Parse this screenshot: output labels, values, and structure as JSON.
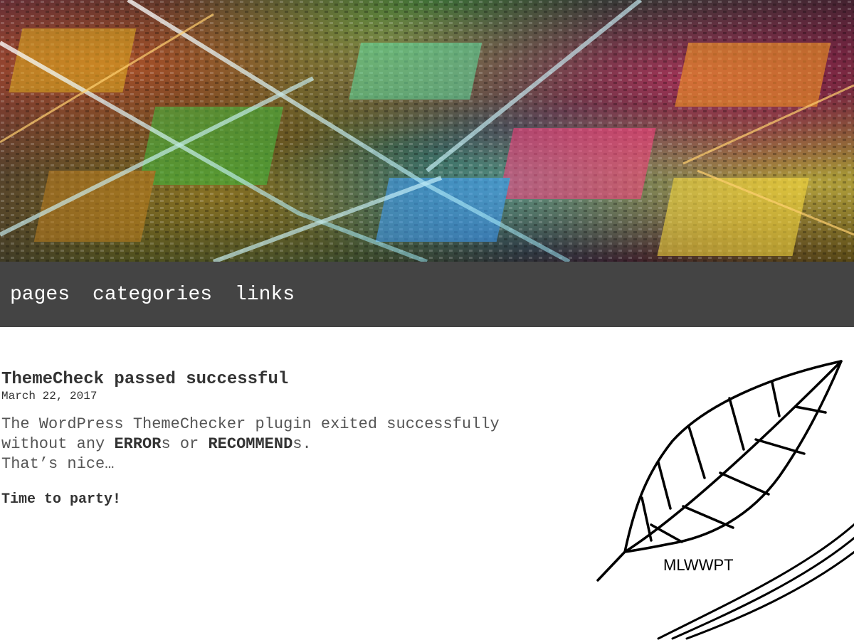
{
  "nav": {
    "items": [
      {
        "label": "pages"
      },
      {
        "label": "categories"
      },
      {
        "label": "links"
      }
    ]
  },
  "post": {
    "title": "ThemeCheck passed successful",
    "date": "March 22, 2017",
    "body_line1": "The WordPress ThemeChecker plugin exited successfully",
    "body_line2_prefix": "without any ",
    "body_error": "ERROR",
    "body_s1": "s or ",
    "body_recommend": "RECOMMEND",
    "body_s2": "s.",
    "body_line3": "That’s nice…",
    "party": "Time to party!"
  },
  "logo": {
    "text": "MLWWPT"
  },
  "colors": {
    "nav_background": "#444444",
    "nav_text": "#ffffff",
    "title_text": "#333333",
    "body_text": "#555555"
  }
}
